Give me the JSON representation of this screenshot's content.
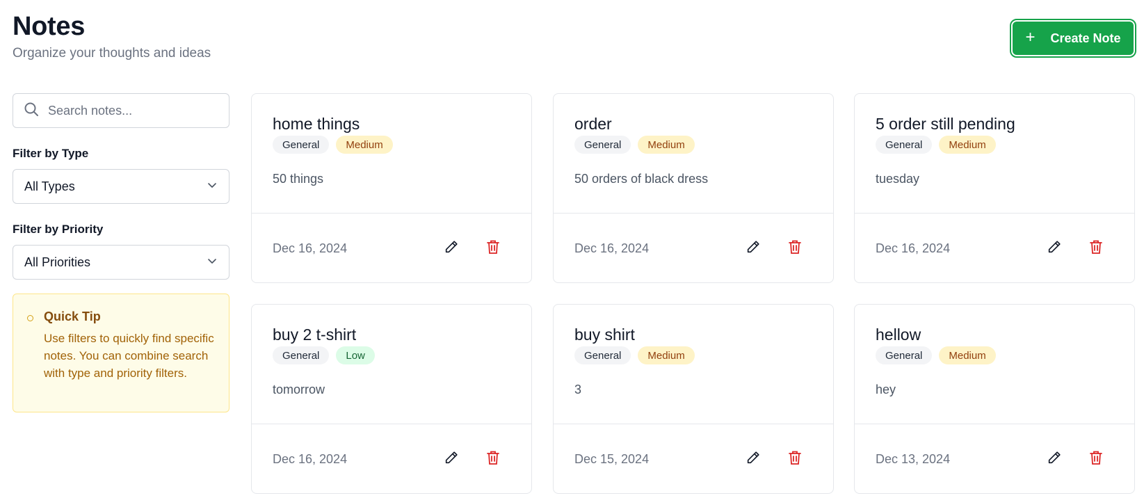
{
  "header": {
    "title": "Notes",
    "subtitle": "Organize your thoughts and ideas",
    "create_button_label": "Create Note"
  },
  "sidebar": {
    "search_placeholder": "Search notes...",
    "filter_type_label": "Filter by Type",
    "filter_type_value": "All Types",
    "filter_priority_label": "Filter by Priority",
    "filter_priority_value": "All Priorities",
    "tip": {
      "title": "Quick Tip",
      "text": "Use filters to quickly find specific notes. You can combine search with type and priority filters."
    }
  },
  "notes": [
    {
      "title": "home things",
      "type": "General",
      "priority": "Medium",
      "content": "50 things",
      "date": "Dec 16, 2024"
    },
    {
      "title": "order",
      "type": "General",
      "priority": "Medium",
      "content": "50 orders of black dress",
      "date": "Dec 16, 2024"
    },
    {
      "title": "5 order still pending",
      "type": "General",
      "priority": "Medium",
      "content": "tuesday",
      "date": "Dec 16, 2024"
    },
    {
      "title": "buy 2 t-shirt",
      "type": "General",
      "priority": "Low",
      "content": "tomorrow",
      "date": "Dec 16, 2024"
    },
    {
      "title": "buy shirt",
      "type": "General",
      "priority": "Medium",
      "content": "3",
      "date": "Dec 15, 2024"
    },
    {
      "title": "hellow",
      "type": "General",
      "priority": "Medium",
      "content": "hey",
      "date": "Dec 13, 2024"
    }
  ],
  "colors": {
    "accent": "#16a34a",
    "delete": "#dc2626",
    "medium_badge_bg": "#fef3c7",
    "low_badge_bg": "#dcfce7"
  },
  "icons": {
    "create": "plus-icon",
    "search": "search-icon",
    "select": "chevron-down-icon",
    "tip": "circle-icon",
    "edit": "pencil-icon",
    "delete": "trash-icon"
  }
}
